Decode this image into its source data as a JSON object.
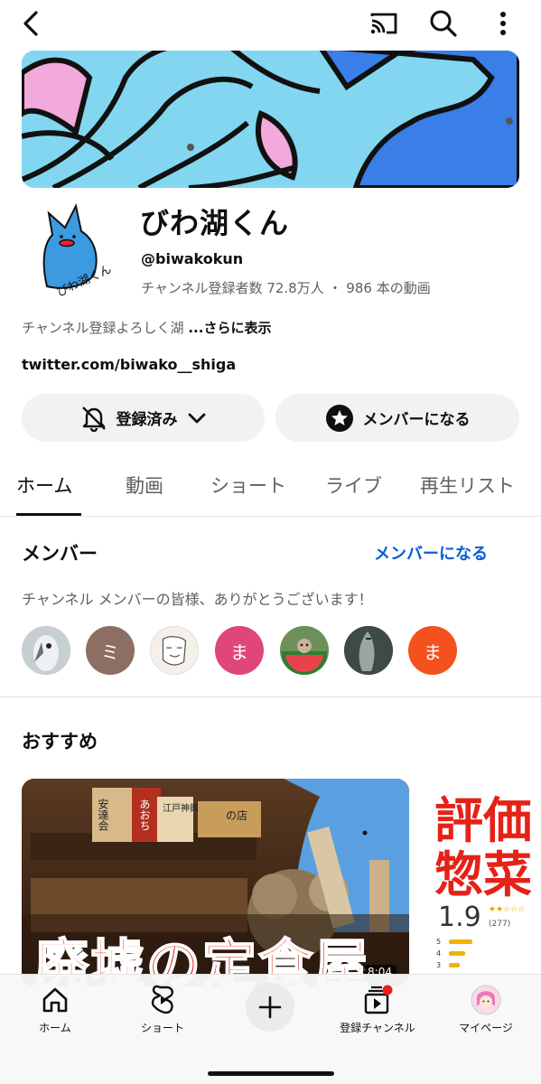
{
  "channel": {
    "name": "びわ湖くん",
    "handle": "@biwakokun",
    "subscribers": "チャンネル登録者数 72.8万人",
    "separator": "・",
    "videos": "986 本の動画",
    "description": "チャンネル登録よろしく湖",
    "more": "...さらに表示",
    "link": "twitter.com/biwako__shiga",
    "avatar_text": "びわ湖くん"
  },
  "buttons": {
    "subscribed": "登録済み",
    "join": "メンバーになる"
  },
  "tabs": [
    "ホーム",
    "動画",
    "ショート",
    "ライブ",
    "再生リスト"
  ],
  "members": {
    "title": "メンバー",
    "join_link": "メンバーになる",
    "thanks": "チャンネル メンバーの皆様、ありがとうございます！",
    "avatars": [
      {
        "type": "image",
        "icon": "bird-avatar",
        "color": "#b8c4c8"
      },
      {
        "type": "letter",
        "letter": "ミ",
        "color": "#8d6e63"
      },
      {
        "type": "image",
        "icon": "sketch-avatar",
        "color": "#f3efe8"
      },
      {
        "type": "letter",
        "letter": "ま",
        "color": "#e0457b"
      },
      {
        "type": "image",
        "icon": "watermelon-avatar",
        "color": "#4caf50"
      },
      {
        "type": "image",
        "icon": "fish-avatar",
        "color": "#5d6b66"
      },
      {
        "type": "letter",
        "letter": "ま",
        "color": "#f4511e"
      }
    ]
  },
  "recommended": {
    "title": "おすすめ",
    "video1": {
      "title_overlay": "廃墟の定食屋",
      "duration": "8:04",
      "signs": [
        "安達会",
        "あおち",
        "江戸神輿",
        "の店"
      ]
    },
    "video2": {
      "title_overlay_1": "評価",
      "title_overlay_2": "惣菜",
      "rating": "1.9",
      "stars": "★★☆☆☆",
      "count": "(277)",
      "rows": [
        "5",
        "4",
        "3"
      ]
    }
  },
  "bottom_nav": [
    {
      "label": "ホーム",
      "icon": "home-icon"
    },
    {
      "label": "ショート",
      "icon": "shorts-icon"
    },
    {
      "label": "",
      "icon": "create-icon"
    },
    {
      "label": "登録チャンネル",
      "icon": "subscriptions-icon"
    },
    {
      "label": "マイページ",
      "icon": "profile-avatar"
    }
  ],
  "colors": {
    "accent_blue": "#065fd4",
    "banner_blue": "#7fd3ee",
    "character_blue": "#3b82f6",
    "pink": "#f0a8d8",
    "red": "#e62117"
  }
}
